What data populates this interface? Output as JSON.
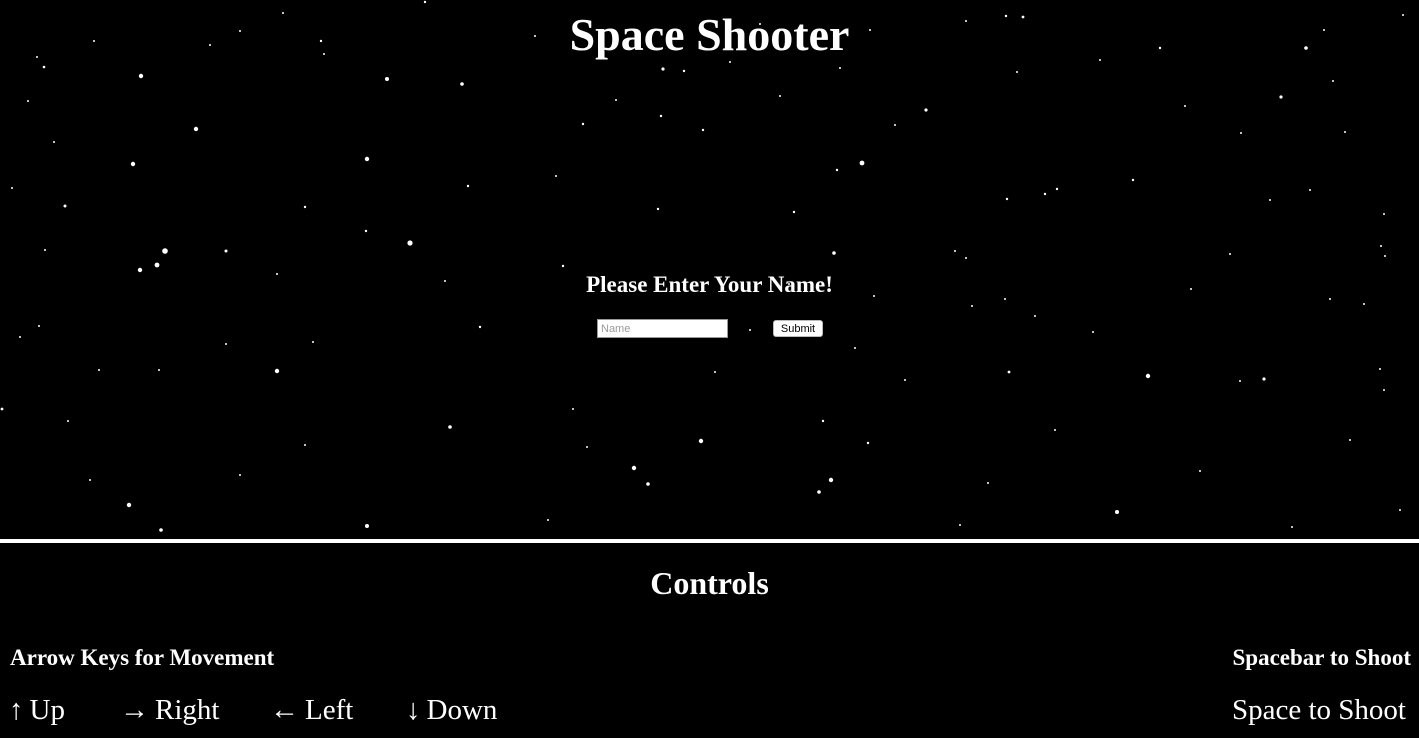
{
  "game": {
    "title": "Space Shooter",
    "name_prompt": "Please Enter Your Name!",
    "name_input": {
      "placeholder": "Name",
      "value": ""
    },
    "submit_label": "Submit"
  },
  "controls": {
    "heading": "Controls",
    "movement_heading": "Arrow Keys for Movement",
    "shoot_heading": "Spacebar to Shoot",
    "keys": [
      {
        "icon": "arrow-up-icon",
        "glyph": "↑",
        "label": "Up"
      },
      {
        "icon": "arrow-right-icon",
        "glyph": "→",
        "label": "Right"
      },
      {
        "icon": "arrow-left-icon",
        "glyph": "←",
        "label": "Left"
      },
      {
        "icon": "arrow-down-icon",
        "glyph": "↓",
        "label": "Down"
      }
    ],
    "shoot_label": "Space to Shoot"
  },
  "colors": {
    "background": "#000000",
    "text": "#ffffff",
    "stars": "#ffffff"
  }
}
